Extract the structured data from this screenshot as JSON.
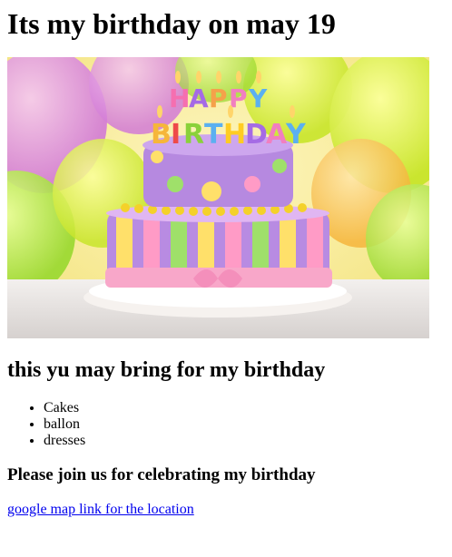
{
  "heading": "Its my birthday on may 19",
  "hero_image": {
    "icon": "birthday-cake-image",
    "banner_text": "HAPPY BIRTHDAY"
  },
  "subheading": "this yu may bring for my birthday",
  "items": [
    "Cakes",
    "ballon",
    "dresses"
  ],
  "invite": "Please join us for celebrating my birthday",
  "map_link": "google map link for the location",
  "colors": {
    "link": "#0000ee",
    "text": "#000000"
  }
}
